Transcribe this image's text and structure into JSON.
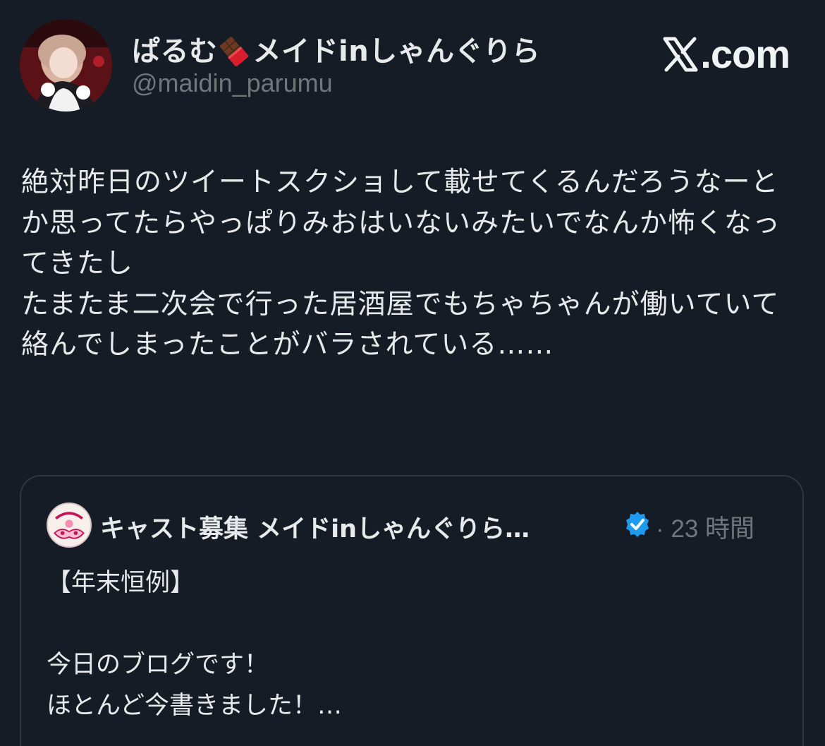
{
  "tweet": {
    "author_name_before": "ぱるむ",
    "author_name_after": "メイドinしゃんぐりら",
    "emoji": "chocolate-bar-icon",
    "handle": "@maidin_parumu",
    "brand": ".com",
    "text": "絶対昨日のツイートスクショして載せてくるんだろうなーとか思ってたらやっぱりみおはいないみたいでなんか怖くなってきたし\nたまたま二次会で行った居酒屋でもちゃちゃんが働いていて絡んでしまったことがバラされている……"
  },
  "quoted": {
    "author_name": "キャスト募集 メイドinしゃんぐりら…",
    "meta": "· 23 時間",
    "text": "【年末恒例】\n\n今日のブログです！\nほとんど今書きました！…",
    "verified_color": "#1d9bf0"
  }
}
